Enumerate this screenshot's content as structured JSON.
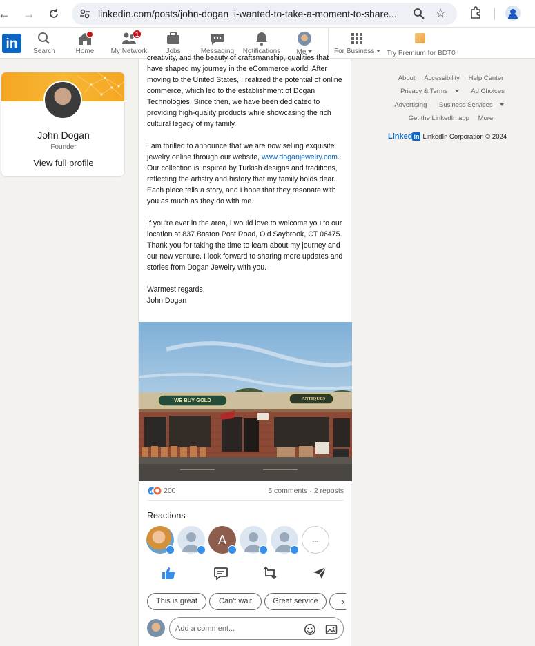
{
  "browser": {
    "url": "linkedin.com/posts/john-dogan_i-wanted-to-take-a-moment-to-share..."
  },
  "nav": {
    "logo": "in",
    "items": [
      {
        "label": "Search",
        "icon": "search-icon"
      },
      {
        "label": "Home",
        "icon": "home-icon",
        "badge": ""
      },
      {
        "label": "My Network",
        "icon": "network-icon",
        "badge": "1"
      },
      {
        "label": "Jobs",
        "icon": "briefcase-icon"
      },
      {
        "label": "Messaging",
        "icon": "messaging-icon"
      },
      {
        "label": "Notifications",
        "icon": "bell-icon"
      },
      {
        "label": "Me",
        "icon": "avatar"
      },
      {
        "label": "For Business",
        "icon": "grid-icon"
      },
      {
        "label": "Try Premium for BDT0",
        "icon": "premium-icon"
      }
    ]
  },
  "profile_card": {
    "name": "John Dogan",
    "headline": "Founder",
    "link": "View full profile"
  },
  "post": {
    "para1": "creativity, and the beauty of craftsmanship, qualities that have shaped my journey in the eCommerce world. After moving to the United States, I realized the potential of online commerce, which led to the establishment of Dogan Technologies. Since then, we have been dedicated to providing high-quality products while showcasing the rich cultural legacy of my family.",
    "para2_before": "I am thrilled to announce that we are now selling exquisite jewelry online through our website, ",
    "para2_link": "www.doganjewelry.com",
    "para2_after": ". Our collection is inspired by Turkish designs and traditions, reflecting the artistry and history that my family holds dear. Each piece tells a story, and I hope that they resonate with you as much as they do with me.",
    "para3": "If you're ever in the area, I would love to welcome you to our location at 837 Boston Post Road, Old Saybrook, CT 06475. Thank you for taking the time to learn about my journey and our new venture. I look forward to sharing more updates and stories from Dogan Jewelry with you.",
    "signoff": "Warmest regards,",
    "signature": "John Dogan",
    "photo": {
      "sign_left": "WE BUY GOLD",
      "sign_right": "ANTIQUES"
    }
  },
  "social": {
    "reaction_count": "200",
    "comments_reposts": "5 comments · 2 reposts"
  },
  "reactions": {
    "title": "Reactions",
    "more": "...",
    "initial": "A"
  },
  "actions": [
    {
      "name": "like-icon",
      "color": "#378fe9"
    },
    {
      "name": "comment-icon"
    },
    {
      "name": "repost-icon"
    },
    {
      "name": "send-icon"
    }
  ],
  "chips": [
    "This is great",
    "Can't wait",
    "Great service"
  ],
  "comment": {
    "placeholder": "Add a comment..."
  },
  "footer": {
    "row1": [
      "About",
      "Accessibility",
      "Help Center"
    ],
    "row2": [
      "Privacy & Terms",
      "Ad Choices"
    ],
    "row3": [
      "Advertising",
      "Business Services"
    ],
    "row4": [
      "Get the LinkedIn app",
      "More"
    ],
    "brand_word": "Linked",
    "brand_box": "in",
    "copyright": "LinkedIn Corporation © 2024"
  },
  "colors": {
    "accent": "#0a66c2",
    "like": "#378fe9",
    "banner": "#f5a623",
    "badge": "#cc1016"
  }
}
